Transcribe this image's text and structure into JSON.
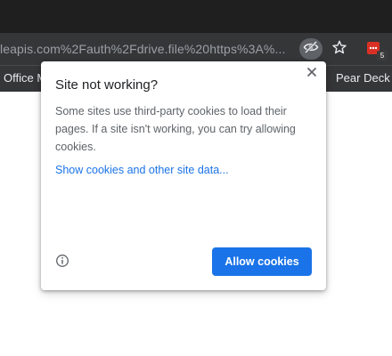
{
  "browser": {
    "omnibox": {
      "url_text": "leapis.com%2Fauth%2Fdrive.file%20https%3A%..."
    },
    "toolbar": {
      "cookie_icon": "eye-crossed-icon",
      "bookmark_icon": "star-icon",
      "extension_icon": "calendar-grid-icon",
      "extension_badge": "5"
    },
    "bookmarks_bar": {
      "left_item": "Office M",
      "right_item": "Pear Deck S"
    }
  },
  "popup": {
    "title": "Site not working?",
    "body": "Some sites use third-party cookies to load their pages. If a site isn't working, you can try allowing cookies.",
    "link": "Show cookies and other site data...",
    "allow_button": "Allow cookies",
    "info_icon": "info-icon",
    "close_icon": "close-icon"
  },
  "colors": {
    "accent": "#1a73e8",
    "toolbar": "#353638",
    "titlebar": "#1f1f1f"
  }
}
